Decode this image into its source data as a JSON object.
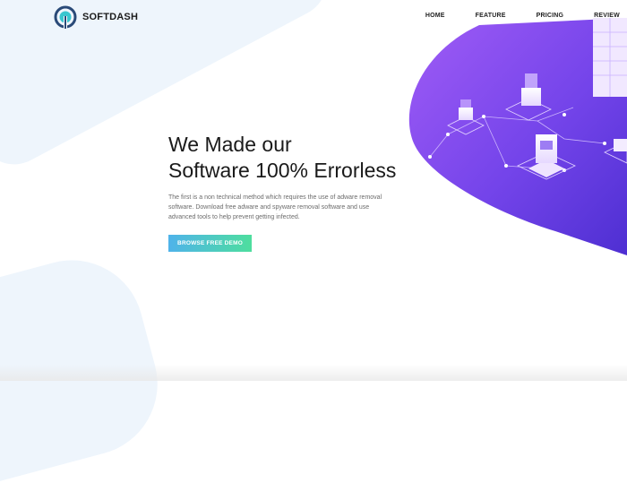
{
  "brand": {
    "name": "SOFTDASH",
    "icon": "signal-tower-icon"
  },
  "nav": {
    "items": [
      "HOME",
      "FEATURE",
      "PRICING",
      "REVIEW"
    ]
  },
  "hero": {
    "title_line1": "We Made our",
    "title_line2": "Software 100% Errorless",
    "description": "The first is a non technical method which requires the use of adware removal software. Download free adware and spyware removal software and use advanced tools to help prevent getting infected.",
    "cta_label": "BROWSE FREE DEMO"
  },
  "colors": {
    "accent_purple": "#7b3fe8",
    "cta_gradient_start": "#4fb3ea",
    "cta_gradient_end": "#4ede9e",
    "text_dark": "#1a1a1a"
  }
}
